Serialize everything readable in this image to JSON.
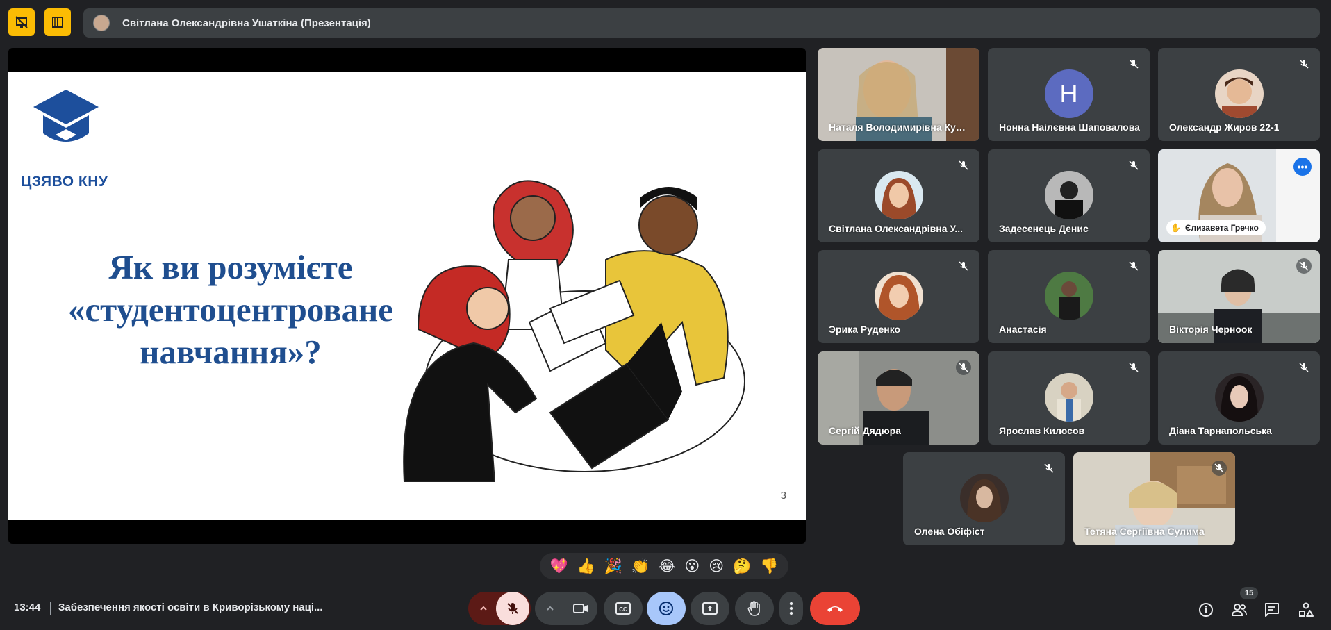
{
  "top": {
    "presenter_label": "Світлана Олександрівна Ушаткіна (Презентація)"
  },
  "slide": {
    "logo_text": "ЦЗЯВО КНУ",
    "title_line1": "Як ви розумієте",
    "title_line2": "«студентоцентроване",
    "title_line3": "навчання»?",
    "page_number": "3"
  },
  "participants": [
    {
      "name": "Наталя Володимирівна Куш..."
    },
    {
      "name": "Нонна Наілєвна Шаповалова",
      "initial": "H"
    },
    {
      "name": "Олександр Жиров 22-1"
    },
    {
      "name": "Світлана Олександрівна У..."
    },
    {
      "name": "Задесенець Денис"
    },
    {
      "name": "Єлизавета Гречко"
    },
    {
      "name": "Эрика Руденко"
    },
    {
      "name": "Анастасія"
    },
    {
      "name": "Вікторія Черноок"
    },
    {
      "name": "Сергій Дядюра"
    },
    {
      "name": "Ярослав Килосов"
    },
    {
      "name": "Діана Тарнапольська"
    },
    {
      "name": "Олена Обіфіст"
    },
    {
      "name": "Тетяна Сергіївна Сулима"
    }
  ],
  "reactions": [
    "💖",
    "👍",
    "🎉",
    "👏",
    "😂",
    "😮",
    "😢",
    "🤔",
    "👎"
  ],
  "bottom": {
    "time": "13:44",
    "meeting_title": "Забезпечення якості освіти в Криворізькому наці...",
    "people_count": "15"
  },
  "colors": {
    "accent_yellow": "#fbbc04",
    "end_call_red": "#ea4335",
    "mic_off_bg": "#f9dedc",
    "emoji_active": "#a8c7fa",
    "active_speaker": "#8ab4f8"
  }
}
